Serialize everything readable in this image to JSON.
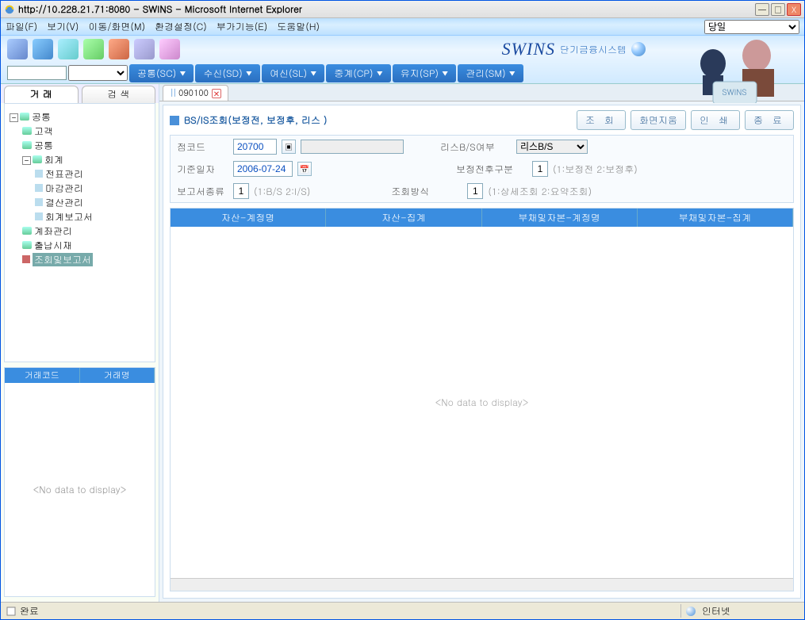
{
  "window": {
    "title": "http://10.228.21.71:8080 - SWINS - Microsoft Internet Explorer"
  },
  "menubar": {
    "items": [
      "파일(F)",
      "보기(V)",
      "이동/화면(M)",
      "환경설정(C)",
      "부가기능(E)",
      "도움말(H)"
    ],
    "day_select": "당일"
  },
  "brand": {
    "name": "SWINS",
    "sub": "단기금융시스템",
    "illust_label": "SWINS"
  },
  "nav": {
    "items": [
      {
        "label": "공통(SC)"
      },
      {
        "label": "수신(SD)"
      },
      {
        "label": "여신(SL)"
      },
      {
        "label": "중계(CP)"
      },
      {
        "label": "유지(SP)"
      },
      {
        "label": "관리(SM)"
      }
    ],
    "dropdown_icon": "▼"
  },
  "side_tabs": {
    "a": "거  래",
    "b": "검  색"
  },
  "tree": {
    "root": "공통",
    "children": [
      {
        "label": "고객"
      },
      {
        "label": "공통"
      },
      {
        "label": "회계",
        "expanded": true,
        "children": [
          {
            "label": "전표관리"
          },
          {
            "label": "마감관리"
          },
          {
            "label": "결산관리"
          },
          {
            "label": "회계보고서"
          }
        ]
      },
      {
        "label": "계좌관리"
      },
      {
        "label": "출납시재"
      },
      {
        "label": "조회및보고서",
        "selected": true
      }
    ]
  },
  "trade_grid": {
    "cols": [
      "거래코드",
      "거래명"
    ],
    "empty": "<No data to display>"
  },
  "doc_tab": {
    "id": "090100"
  },
  "page": {
    "title": "BS/IS조회(보정전, 보정후, 리스 )",
    "buttons": {
      "query": "조  회",
      "clear": "화면지움",
      "print": "인  쇄",
      "close": "종  료"
    }
  },
  "form": {
    "branch_lbl": "점코드",
    "branch_val": "20700",
    "lease_lbl": "리스B/S여부",
    "lease_val": "리스B/S",
    "date_lbl": "기준일자",
    "date_val": "2006-07-24",
    "adj_lbl": "보정전후구분",
    "adj_val": "1",
    "adj_hint": "(1:보정전 2:보정후)",
    "report_lbl": "보고서종류",
    "report_val": "1",
    "report_hint": "(1:B/S 2:I/S)",
    "view_lbl": "조회방식",
    "view_val": "1",
    "view_hint": "(1:상세조회 2:요약조회)"
  },
  "grid": {
    "cols": [
      "자산-계정명",
      "자산-집계",
      "부채및자본-계정명",
      "부채및자본-집계"
    ],
    "empty": "<No data to display>"
  },
  "status": {
    "left": "완료",
    "right": "인터넷"
  }
}
